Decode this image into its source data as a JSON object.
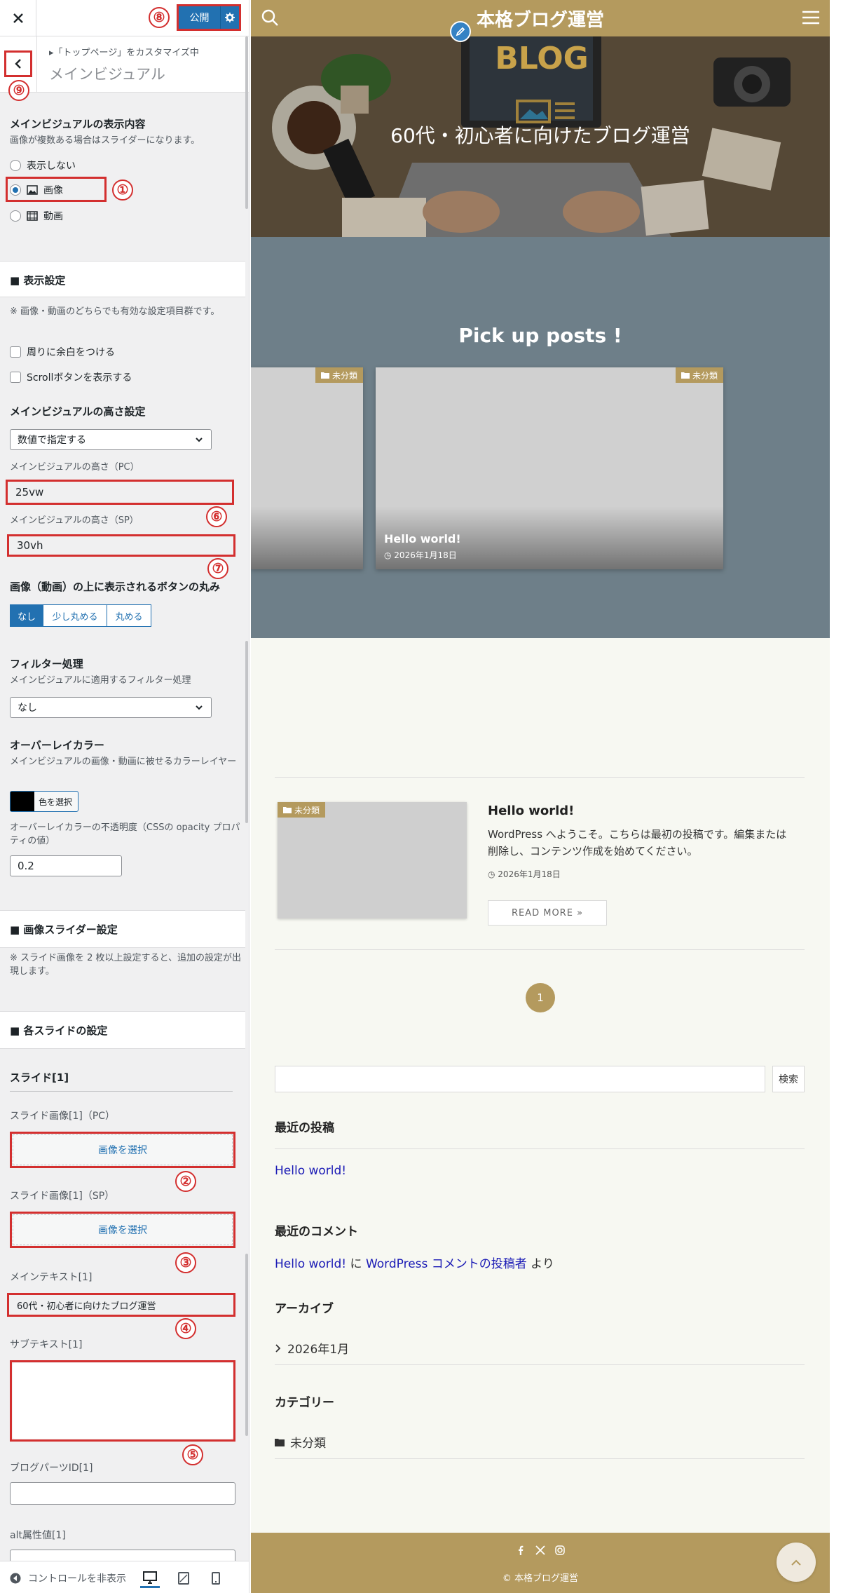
{
  "panel": {
    "close_icon": "close-icon",
    "publish_label": "公開",
    "customizing_label": "▸「トップページ」をカスタマイズ中",
    "section_title": "メインビジュアル",
    "display_content": {
      "label": "メインビジュアルの表示内容",
      "desc": "画像が複数ある場合はスライダーになります。",
      "options": [
        "表示しない",
        "画像",
        "動画"
      ],
      "selected": "画像"
    },
    "display_settings": {
      "heading": "■ 表示設定",
      "note": "※ 画像・動画のどちらでも有効な設定項目群です。",
      "checkbox_margin": "周りに余白をつける",
      "checkbox_scroll": "Scrollボタンを表示する"
    },
    "height": {
      "label": "メインビジュアルの高さ設定",
      "select_value": "数値で指定する",
      "pc_label": "メインビジュアルの高さ（PC）",
      "pc_value": "25vw",
      "sp_label": "メインビジュアルの高さ（SP）",
      "sp_value": "30vh"
    },
    "button_radius": {
      "label": "画像（動画）の上に表示されるボタンの丸み",
      "options": [
        "なし",
        "少し丸める",
        "丸める"
      ],
      "selected": "なし"
    },
    "filter": {
      "label": "フィルター処理",
      "desc": "メインビジュアルに適用するフィルター処理",
      "value": "なし"
    },
    "overlay": {
      "label": "オーバーレイカラー",
      "desc": "メインビジュアルの画像・動画に被せるカラーレイヤー",
      "color_button": "色を選択",
      "color": "#000000",
      "opacity_desc": "オーバーレイカラーの不透明度（CSSの opacity プロパティの値）",
      "opacity_value": "0.2"
    },
    "slider": {
      "heading": "■ 画像スライダー設定",
      "note": "※ スライド画像を 2 枚以上設定すると、追加の設定が出現します。"
    },
    "slides": {
      "heading": "■ 各スライドの設定",
      "slide_title": "スライド[1]",
      "image_pc_label": "スライド画像[1]（PC）",
      "image_sp_label": "スライド画像[1]（SP）",
      "select_image": "画像を選択",
      "main_text_label": "メインテキスト[1]",
      "main_text_value": "60代・初心者に向けたブログ運営",
      "sub_text_label": "サブテキスト[1]",
      "parts_id_label": "ブログパーツID[1]",
      "alt_label": "alt属性値[1]"
    },
    "footer": {
      "collapse_label": "コントロールを非表示"
    },
    "badges": [
      "①",
      "②",
      "③",
      "④",
      "⑤",
      "⑥",
      "⑦",
      "⑧",
      "⑨"
    ]
  },
  "preview": {
    "site_title": "本格ブログ運営",
    "hero_text": "60代・初心者に向けたブログ運営",
    "hero_sign": "BLOG",
    "pickup_title": "Pick up posts !",
    "category": "未分類",
    "card_title": "Hello world!",
    "card_date": "2026年1月18日",
    "post": {
      "title": "Hello world!",
      "excerpt": "WordPress へようこそ。こちらは最初の投稿です。編集または削除し、コンテンツ作成を始めてください。",
      "date": "2026年1月18日",
      "read_more": "READ MORE »"
    },
    "page_number": "1",
    "search_button": "検索",
    "recent_posts_heading": "最近の投稿",
    "recent_post_link": "Hello world!",
    "recent_comments_heading": "最近のコメント",
    "comment_post": "Hello world!",
    "comment_join": " に ",
    "comment_author": "WordPress コメントの投稿者",
    "comment_tail": " より",
    "archives_heading": "アーカイブ",
    "archive_item": "2026年1月",
    "categories_heading": "カテゴリー",
    "category_item": "未分類",
    "copyright": "© 本格ブログ運営"
  },
  "colors": {
    "accent_gold": "#b49a5e",
    "wp_blue": "#2271b1",
    "annotation_red": "#d32f2f",
    "pickup_bg": "#6e7f89"
  }
}
